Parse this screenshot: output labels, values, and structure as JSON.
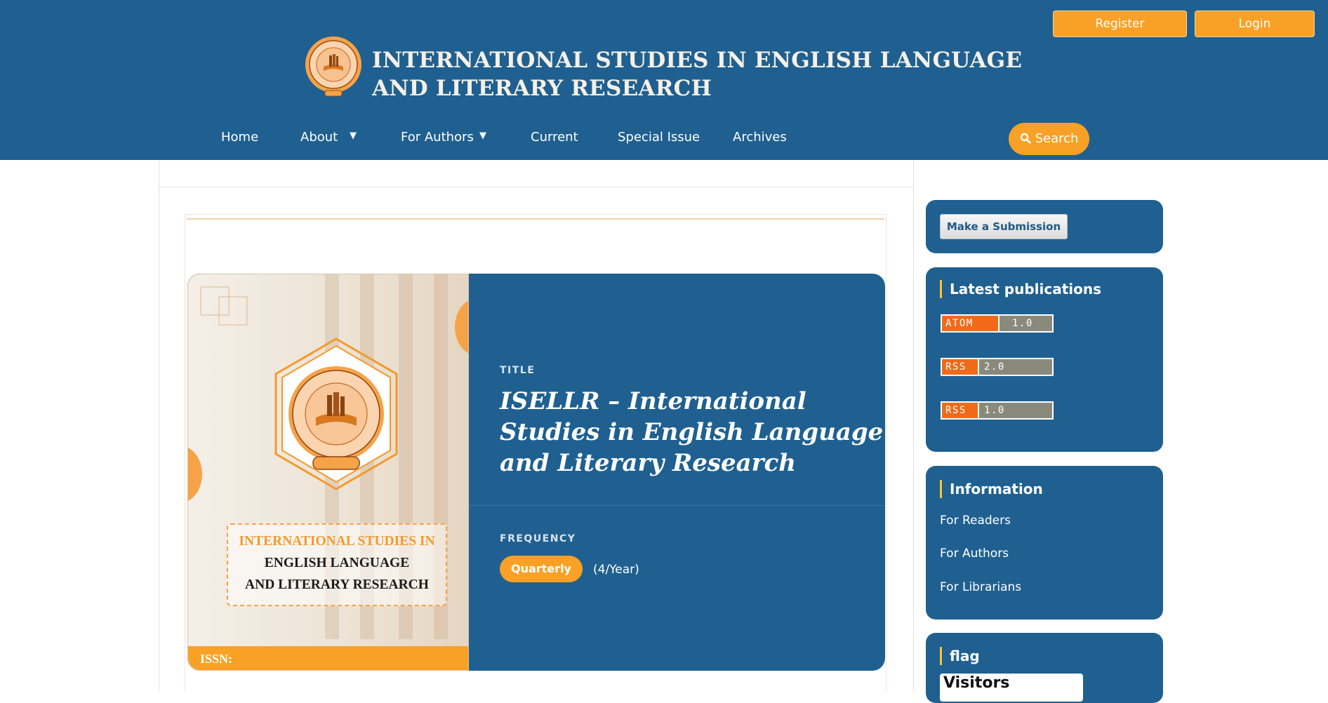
{
  "header": {
    "register_label": "Register",
    "login_label": "Login",
    "title_line1": "INTERNATIONAL STUDIES IN ENGLISH LANGUAGE",
    "title_line2": "AND LITERARY RESEARCH",
    "search_label": "Search",
    "nav": [
      {
        "label": "Home",
        "has_dropdown": false
      },
      {
        "label": "About",
        "has_dropdown": true
      },
      {
        "label": "For Authors",
        "has_dropdown": true
      },
      {
        "label": "Current",
        "has_dropdown": false
      },
      {
        "label": "Special Issue",
        "has_dropdown": false
      },
      {
        "label": "Archives",
        "has_dropdown": false
      }
    ]
  },
  "card": {
    "cover": {
      "line1": "INTERNATIONAL STUDIES IN",
      "line2": "ENGLISH LANGUAGE",
      "line3": "AND LITERARY RESEARCH",
      "issn_label": "ISSN:"
    },
    "title_label": "TITLE",
    "title_lines": [
      "ISELLR – International",
      "Studies in English Language",
      "and Literary Research"
    ],
    "frequency_label": "FREQUENCY",
    "frequency_value": "Quarterly",
    "frequency_note": "(4/Year)"
  },
  "sidebar": {
    "submission_label": "Make a Submission",
    "latest_heading": "Latest publications",
    "feeds": [
      {
        "left": "ATOM",
        "right": "1.0"
      },
      {
        "left": "RSS",
        "right": "2.0"
      },
      {
        "left": "RSS",
        "right": "1.0"
      }
    ],
    "info_heading": "Information",
    "info_links": [
      "For Readers",
      "For Authors",
      "For Librarians"
    ],
    "flag_heading": "flag",
    "visitors_label": "Visitors"
  },
  "colors": {
    "brand_blue": "#1f6090",
    "accent_orange": "#f9a126",
    "heading_bar_yellow": "#f7c32e"
  }
}
